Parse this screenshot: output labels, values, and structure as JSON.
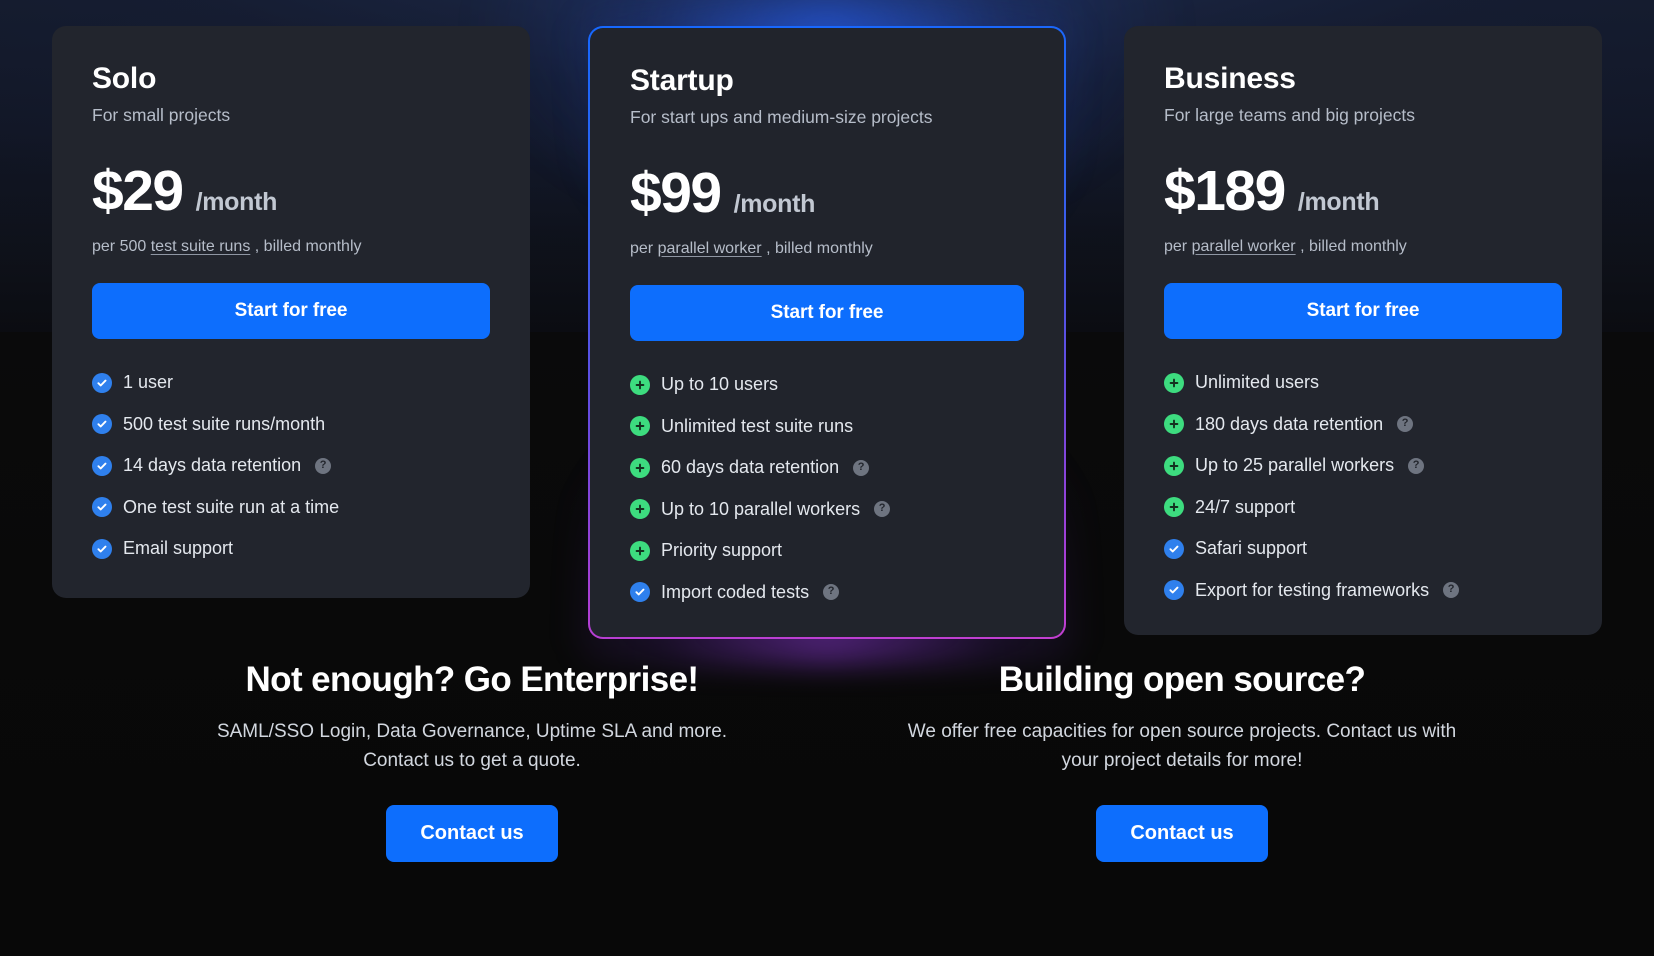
{
  "theme": {
    "accent_blue": "#0d6efd",
    "check_blue": "#2f80ed",
    "plus_green": "#3ddc7f",
    "card_bg": "#21242c",
    "page_bg": "#0a0a0a",
    "featured_border_from": "#1668ff",
    "featured_border_to": "#c23fd0"
  },
  "plans": [
    {
      "name": "Solo",
      "tagline": "For small projects",
      "price": "$29",
      "period": "/month",
      "note_prefix": "per 500 ",
      "note_link": "test suite runs",
      "note_suffix": " , billed monthly",
      "cta_label": "Start for free",
      "featured": false,
      "features": [
        {
          "icon": "check-icon",
          "label": "1 user",
          "help": false
        },
        {
          "icon": "check-icon",
          "label": "500 test suite runs/month",
          "help": false
        },
        {
          "icon": "check-icon",
          "label": "14 days data retention",
          "help": true
        },
        {
          "icon": "check-icon",
          "label": "One test suite run at a time",
          "help": false
        },
        {
          "icon": "check-icon",
          "label": "Email support",
          "help": false
        }
      ]
    },
    {
      "name": "Startup",
      "tagline": "For start ups and medium-size projects",
      "price": "$99",
      "period": "/month",
      "note_prefix": "per ",
      "note_link": "parallel worker",
      "note_suffix": " , billed monthly",
      "cta_label": "Start for free",
      "featured": true,
      "features": [
        {
          "icon": "plus-icon",
          "label": "Up to 10 users",
          "help": false
        },
        {
          "icon": "plus-icon",
          "label": "Unlimited test suite runs",
          "help": false
        },
        {
          "icon": "plus-icon",
          "label": "60 days data retention",
          "help": true
        },
        {
          "icon": "plus-icon",
          "label": "Up to 10 parallel workers",
          "help": true
        },
        {
          "icon": "plus-icon",
          "label": "Priority support",
          "help": false
        },
        {
          "icon": "check-icon",
          "label": "Import coded tests",
          "help": true
        }
      ]
    },
    {
      "name": "Business",
      "tagline": "For large teams and big projects",
      "price": "$189",
      "period": "/month",
      "note_prefix": "per ",
      "note_link": "parallel worker",
      "note_suffix": " , billed monthly",
      "cta_label": "Start for free",
      "featured": false,
      "features": [
        {
          "icon": "plus-icon",
          "label": "Unlimited users",
          "help": false
        },
        {
          "icon": "plus-icon",
          "label": "180 days data retention",
          "help": true
        },
        {
          "icon": "plus-icon",
          "label": "Up to 25 parallel workers",
          "help": true
        },
        {
          "icon": "plus-icon",
          "label": "24/7 support",
          "help": false
        },
        {
          "icon": "check-icon",
          "label": "Safari support",
          "help": false
        },
        {
          "icon": "check-icon",
          "label": "Export for testing frameworks",
          "help": true
        }
      ]
    }
  ],
  "promos": [
    {
      "title": "Not enough? Go Enterprise!",
      "text": "SAML/SSO Login, Data Governance, Uptime SLA and more. Contact us to get a quote.",
      "button_label": "Contact us"
    },
    {
      "title": "Building open source?",
      "text": "We offer free capacities for open source projects. Contact us with your project details for more!",
      "button_label": "Contact us"
    }
  ],
  "help_icon_glyph": "?"
}
